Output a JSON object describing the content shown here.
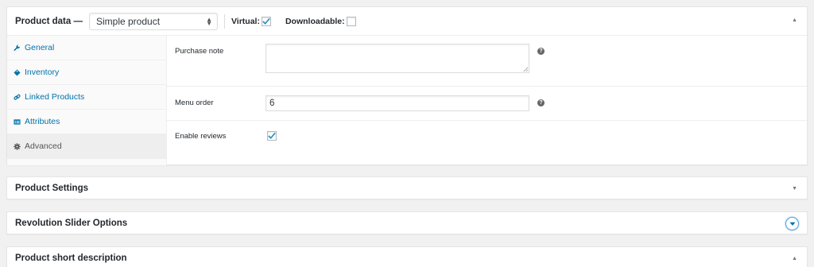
{
  "product_data": {
    "title": "Product data —",
    "product_type": "Simple product",
    "virtual_label": "Virtual:",
    "virtual_checked": true,
    "downloadable_label": "Downloadable:",
    "downloadable_checked": false,
    "toggle_icon": "arrow-up-icon"
  },
  "tabs": [
    {
      "label": "General",
      "icon": "wrench-icon",
      "active": false
    },
    {
      "label": "Inventory",
      "icon": "tag-icon",
      "active": false
    },
    {
      "label": "Linked Products",
      "icon": "link-icon",
      "active": false
    },
    {
      "label": "Attributes",
      "icon": "table-icon",
      "active": false
    },
    {
      "label": "Advanced",
      "icon": "gear-icon",
      "active": true
    }
  ],
  "fields": {
    "purchase_note_label": "Purchase note",
    "purchase_note_value": "",
    "menu_order_label": "Menu order",
    "menu_order_value": "6",
    "enable_reviews_label": "Enable reviews",
    "enable_reviews_checked": true,
    "help_glyph": "?"
  },
  "boxes": {
    "product_settings": "Product Settings",
    "revolution_slider": "Revolution Slider Options",
    "short_description": "Product short description"
  },
  "colors": {
    "link": "#0073aa",
    "checkmark": "#1e8cbe",
    "background": "#f1f1f1"
  }
}
